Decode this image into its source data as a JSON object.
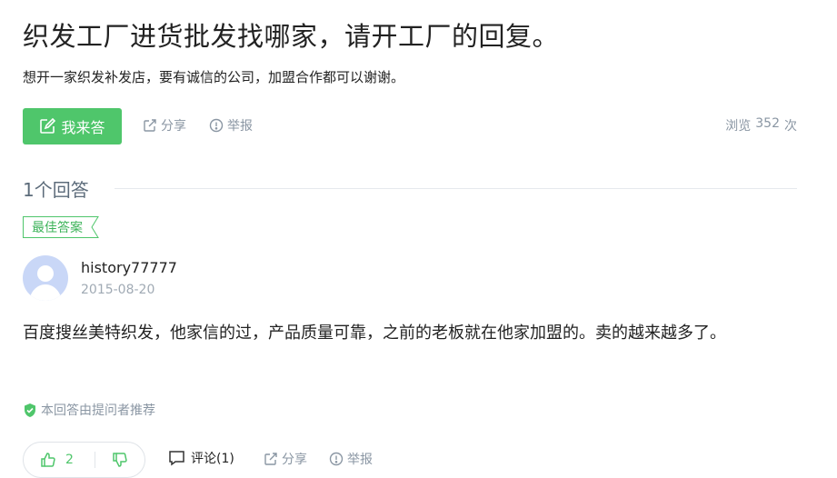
{
  "question": {
    "title": "织发工厂进货批发找哪家，请开工厂的回复。",
    "description": "想开一家织发补发店，要有诚信的公司，加盟合作都可以谢谢。"
  },
  "actions": {
    "answer_label": "我来答",
    "share_label": "分享",
    "report_label": "举报",
    "views_prefix": "浏览",
    "views_count": "352",
    "views_suffix": "次"
  },
  "answers_header": {
    "count_label": "1个回答"
  },
  "best_answer": {
    "tag": "最佳答案",
    "username": "history77777",
    "date": "2015-08-20",
    "content": "百度搜丝美特织发，他家信的过，产品质量可靠，之前的老板就在他家加盟的。卖的越来越多了。",
    "recommend_note": "本回答由提问者推荐",
    "upvotes": "2",
    "comment_label": "评论(1)",
    "share_label": "分享",
    "report_label": "举报"
  },
  "colors": {
    "accent": "#4fc66b",
    "muted": "#8a96a3",
    "avatar_bg": "#c9d7f7"
  }
}
